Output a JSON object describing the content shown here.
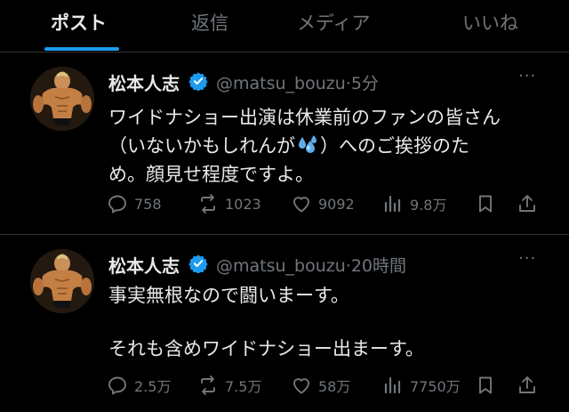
{
  "tabs": [
    {
      "label": "ポスト",
      "active": true
    },
    {
      "label": "返信",
      "active": false
    },
    {
      "label": "メディア",
      "active": false
    },
    {
      "label": "いいね",
      "active": false
    }
  ],
  "tweets": [
    {
      "display_name": "松本人志",
      "handle": "@matsu_bouzu",
      "separator": "·",
      "time": "5分",
      "more": "···",
      "lines": [
        "ワイドナショー出演は休業前のファンの皆さん",
        "（いないかもしれんが",
        "）へのご挨拶のた",
        "め。顔見せ程度ですよ。"
      ],
      "stats": {
        "replies": "758",
        "reposts": "1023",
        "likes": "9092",
        "views": "9.8万"
      }
    },
    {
      "display_name": "松本人志",
      "handle": "@matsu_bouzu",
      "separator": "·",
      "time": "20時間",
      "more": "···",
      "lines": [
        "事実無根なので闘いまーす。",
        "それも含めワイドナショー出まーす。"
      ],
      "stats": {
        "replies": "2.5万",
        "reposts": "7.5万",
        "likes": "58万",
        "views": "7750万"
      }
    }
  ],
  "colors": {
    "accent": "#1d9bf0",
    "text": "#e7e9ea",
    "muted": "#71767b",
    "divider": "#2f3336",
    "background": "#000000"
  },
  "icons": [
    "verified-badge-icon",
    "sweat-droplets-emoji-icon",
    "reply-icon",
    "repost-icon",
    "like-icon",
    "views-icon",
    "bookmark-icon",
    "share-icon"
  ]
}
